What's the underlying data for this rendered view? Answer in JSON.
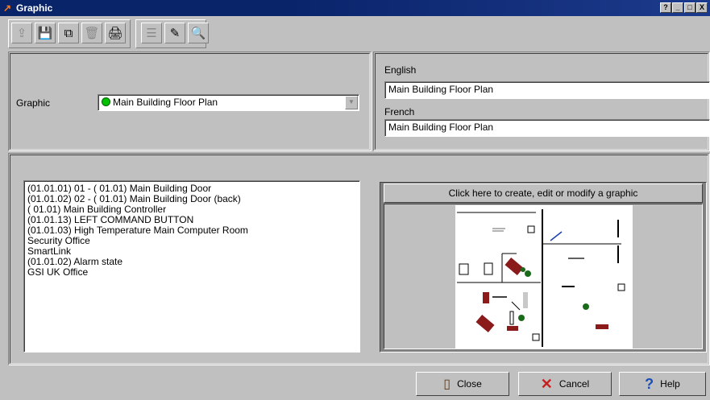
{
  "window": {
    "title": "Graphic",
    "buttons": [
      "?",
      "_",
      "□",
      "X"
    ]
  },
  "toolbar": {
    "buttons": [
      {
        "name": "export-icon",
        "glyph": "⇪",
        "disabled": true
      },
      {
        "name": "save-icon",
        "glyph": "💾",
        "disabled": false
      },
      {
        "name": "copy-icon",
        "glyph": "⧉",
        "disabled": false
      },
      {
        "name": "delete-icon",
        "glyph": "🗑",
        "disabled": true
      },
      {
        "name": "print-icon",
        "glyph": "🖨",
        "disabled": false
      },
      {
        "name": "list-icon",
        "glyph": "☰",
        "disabled": true
      },
      {
        "name": "link-icon",
        "glyph": "✎",
        "disabled": false
      },
      {
        "name": "find-icon",
        "glyph": "🔍",
        "disabled": true
      }
    ]
  },
  "form": {
    "graphic_label": "Graphic",
    "graphic_value": "Main Building Floor Plan",
    "status_color": "#00c000",
    "english_label": "English",
    "english_value": "Main Building Floor Plan",
    "french_label": "French",
    "french_value": "Main Building Floor Plan"
  },
  "items": [
    "(01.01.01) 01 - ( 01.01) Main Building Door",
    "(01.01.02) 02 - ( 01.01) Main Building Door (back)",
    "( 01.01) Main Building Controller",
    "(01.01.13) LEFT COMMAND BUTTON",
    "(01.01.03) High Temperature Main Computer Room",
    "Security Office",
    "SmartLink",
    "(01.01.02) Alarm state",
    "GSI UK Office"
  ],
  "graphic_button": "Click here to create, edit or modify a graphic",
  "footer": {
    "close": "Close",
    "cancel": "Cancel",
    "help": "Help"
  },
  "colors": {
    "titlebar": "#0a246a",
    "face": "#c0c0c0",
    "brick": "#8b1a1a",
    "plant": "#1a6a1a",
    "cancel_x": "#c81e1e",
    "help_q": "#1b4fb8"
  }
}
